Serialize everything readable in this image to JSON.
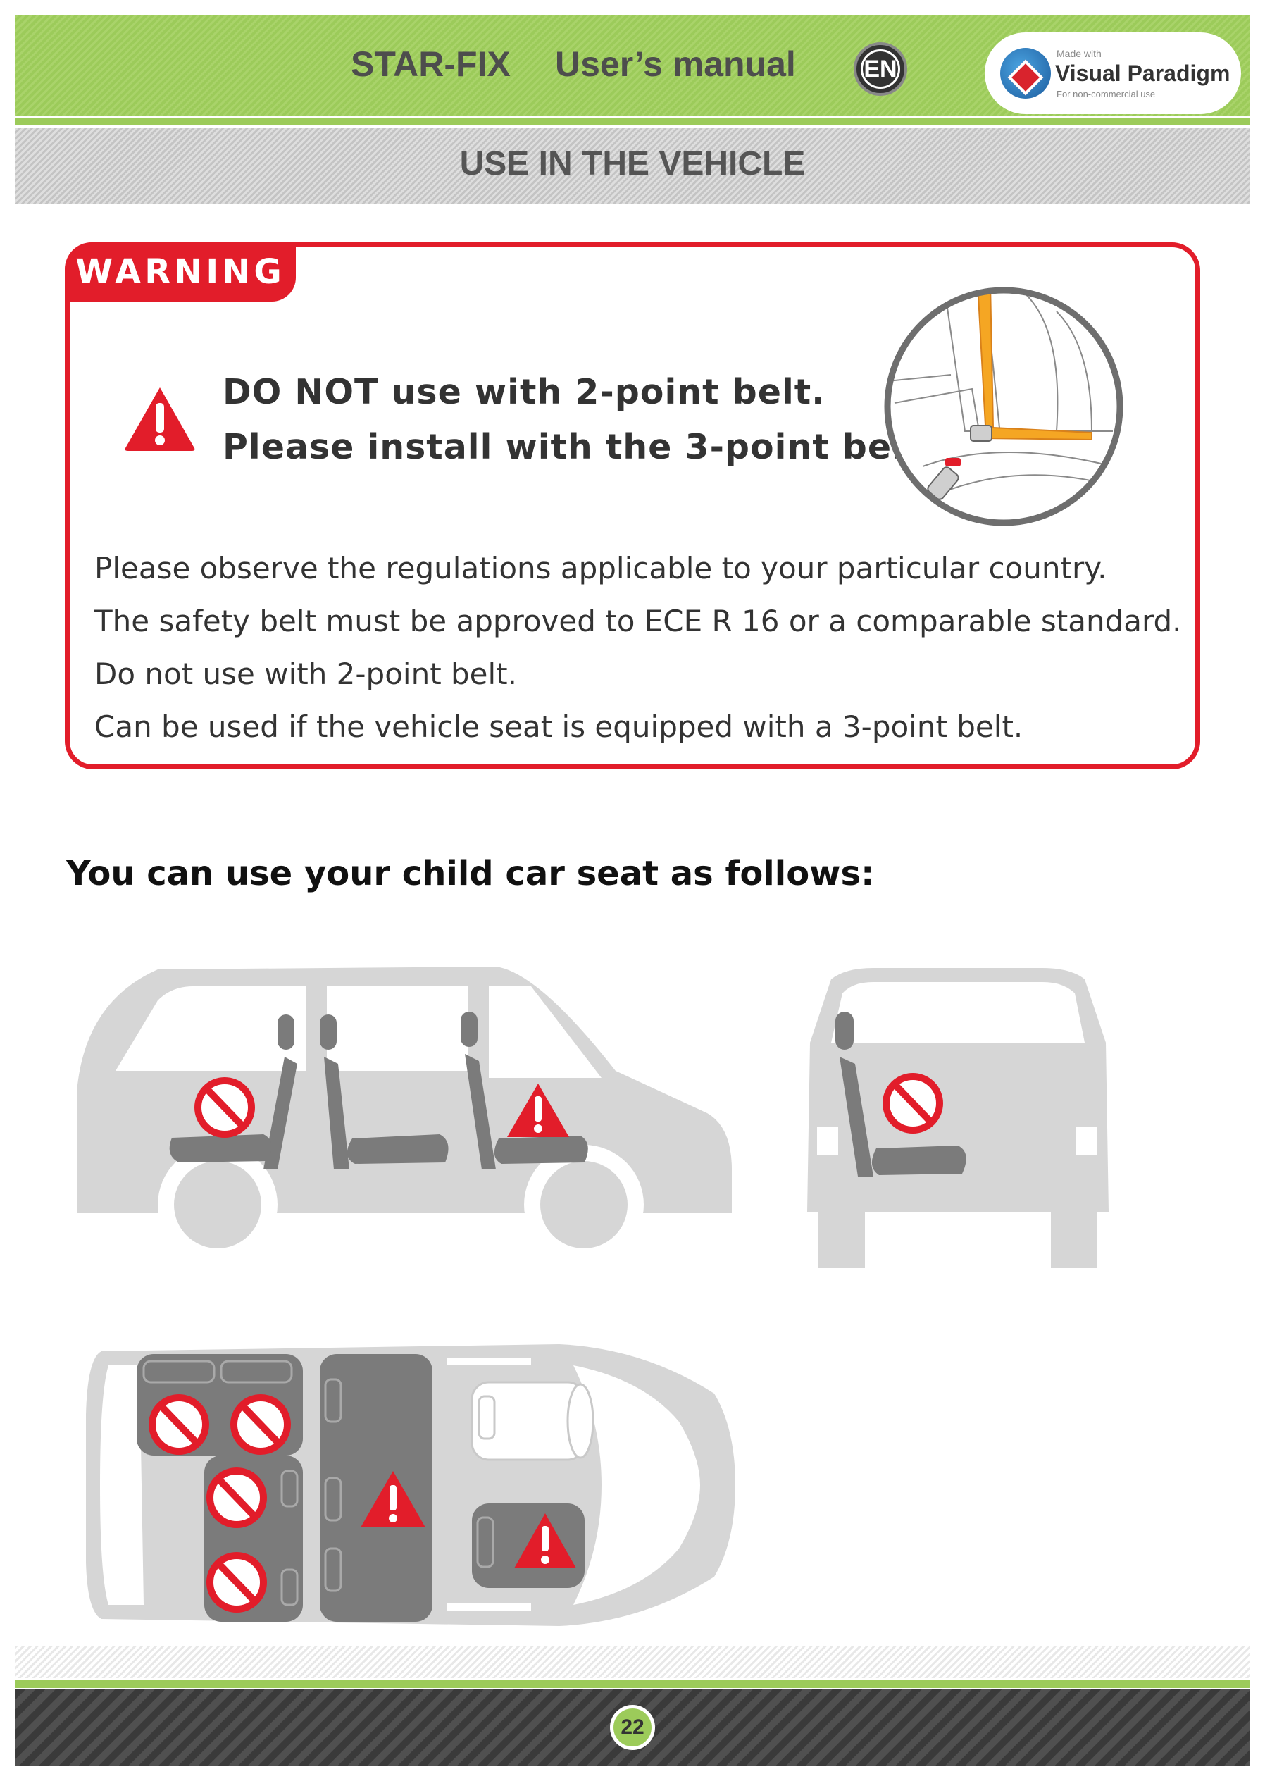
{
  "header": {
    "product": "STAR-FIX",
    "manual": "User’s manual",
    "language_badge": "EN",
    "watermark": {
      "made_with": "Made with",
      "name": "Visual Paradigm",
      "note": "For non-commercial use"
    }
  },
  "section_title": "USE IN THE VEHICLE",
  "warning": {
    "tag": "WARNING",
    "headline": [
      "DO NOT use with 2-point belt.",
      "Please install with the 3-point belt."
    ],
    "lines": [
      "Please observe the regulations applicable to your particular country.",
      "The safety belt must be approved to ECE R 16 or a comparable standard.",
      "Do not use with 2-point belt.",
      "Can be used if the vehicle seat is equipped with a 3-point belt."
    ]
  },
  "follows_heading": "You can use your child car seat as follows:",
  "colors": {
    "accent_red": "#e21d2a",
    "green": "#9ccb5a",
    "car_gray": "#d6d6d6",
    "seat_gray": "#7b7b7b"
  },
  "footer": {
    "page_number": "22"
  }
}
